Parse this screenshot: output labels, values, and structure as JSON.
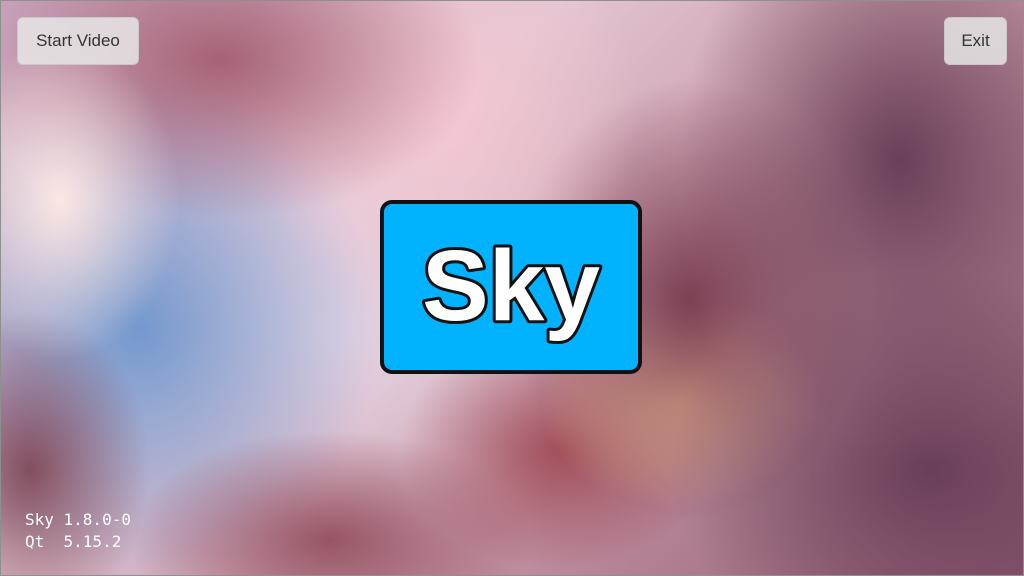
{
  "toolbar": {
    "start_video_label": "Start Video",
    "exit_label": "Exit"
  },
  "logo": {
    "text": "Sky",
    "background_color": "#00b2ff",
    "border_color": "#111111"
  },
  "version": {
    "app_line": "Sky 1.8.0-0",
    "qt_line": "Qt  5.15.2"
  }
}
